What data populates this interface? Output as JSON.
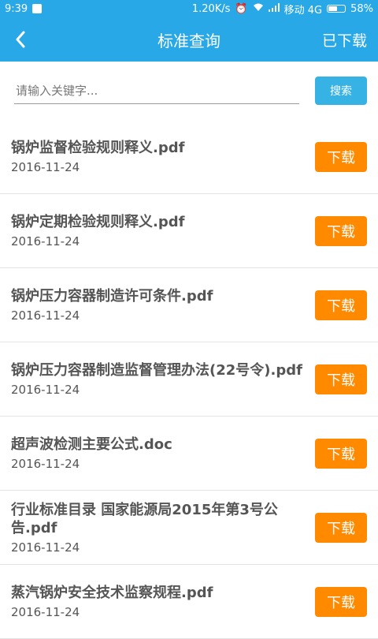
{
  "status_bar": {
    "time": "9:39",
    "speed": "1.20K/s",
    "carrier": "移动 4G",
    "battery": "58%",
    "battery_level": 0.58
  },
  "app_bar": {
    "title": "标准查询",
    "downloaded_label": "已下载"
  },
  "search": {
    "placeholder": "请输入关键字...",
    "value": "",
    "button_label": "搜索"
  },
  "colors": {
    "primary": "#29a8e8",
    "download_button": "#ff8a00"
  },
  "documents": [
    {
      "name": "锅炉监督检验规则释义.pdf",
      "date": "2016-11-24",
      "action": "下载"
    },
    {
      "name": "锅炉定期检验规则释义.pdf",
      "date": "2016-11-24",
      "action": "下载"
    },
    {
      "name": "锅炉压力容器制造许可条件.pdf",
      "date": "2016-11-24",
      "action": "下载"
    },
    {
      "name": "锅炉压力容器制造监督管理办法(22号令).pdf",
      "date": "2016-11-24",
      "action": "下载"
    },
    {
      "name": "超声波检测主要公式.doc",
      "date": "2016-11-24",
      "action": "下载"
    },
    {
      "name": "行业标准目录 国家能源局2015年第3号公告.pdf",
      "date": "2016-11-24",
      "action": "下载"
    },
    {
      "name": "蒸汽锅炉安全技术监察规程.pdf",
      "date": "2016-11-24",
      "action": "下载"
    }
  ]
}
